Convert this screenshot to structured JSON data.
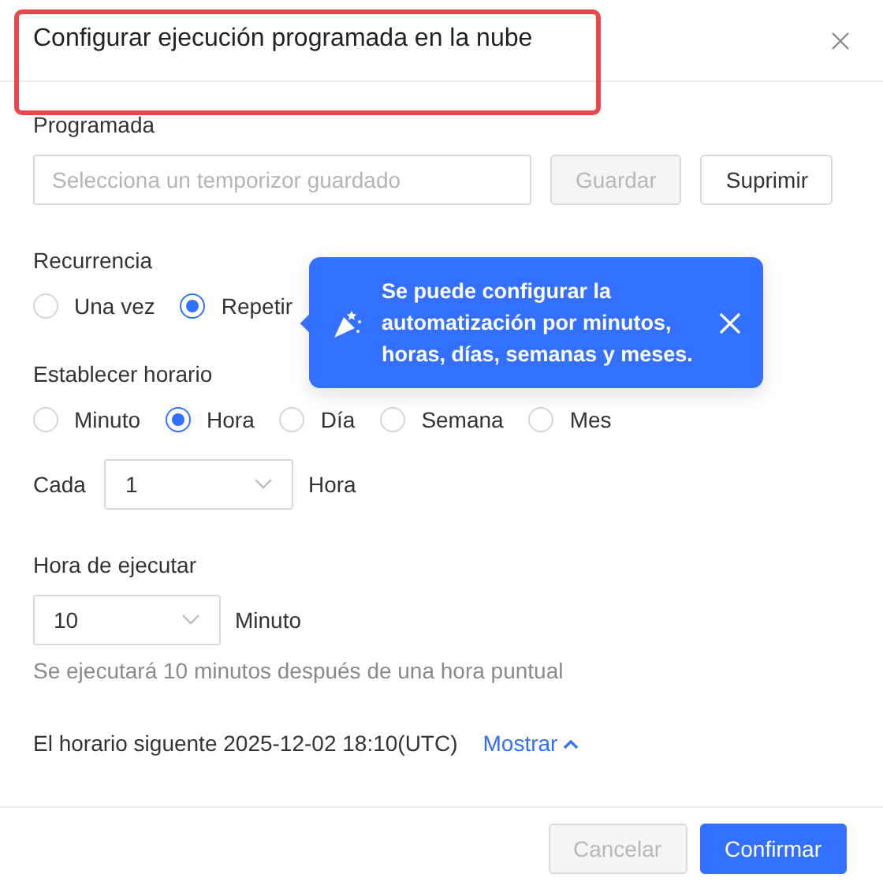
{
  "dialog": {
    "title": "Configurar ejecución programada en la nube",
    "title_highlighted": true
  },
  "saved_timer": {
    "label": "Programada",
    "placeholder": "Selecciona un temporizor guardado",
    "buttons": [
      {
        "label": "Guardar",
        "disabled": true
      },
      {
        "label": "Suprimir",
        "disabled": false
      }
    ]
  },
  "recurrence": {
    "label": "Recurrencia",
    "options": [
      {
        "label": "Una vez",
        "selected": false
      },
      {
        "label": "Repetir",
        "selected": true
      }
    ]
  },
  "tooltip": {
    "text": "Se puede configurar la automatización por minutos, horas, días, semanas y meses."
  },
  "schedule": {
    "label": "Establecer horario",
    "options": [
      {
        "label": "Minuto",
        "selected": false
      },
      {
        "label": "Hora",
        "selected": true
      },
      {
        "label": "Día",
        "selected": false
      },
      {
        "label": "Semana",
        "selected": false
      },
      {
        "label": "Mes",
        "selected": false
      }
    ]
  },
  "interval": {
    "prefix": "Cada",
    "value": "1",
    "unit": "Hora"
  },
  "run_time": {
    "label": "Hora de ejecutar",
    "value": "10",
    "unit": "Minuto",
    "hint": "Se ejecutará 10 minutos después de una hora puntual"
  },
  "next_run": {
    "text": "El horario siguente 2025-12-02 18:10(UTC)",
    "link": "Mostrar",
    "expanded": true
  },
  "footer": {
    "buttons": [
      {
        "label": "Cancelar",
        "kind": "secondary",
        "disabled": true
      },
      {
        "label": "Confirmar",
        "kind": "primary",
        "disabled": false
      }
    ]
  }
}
